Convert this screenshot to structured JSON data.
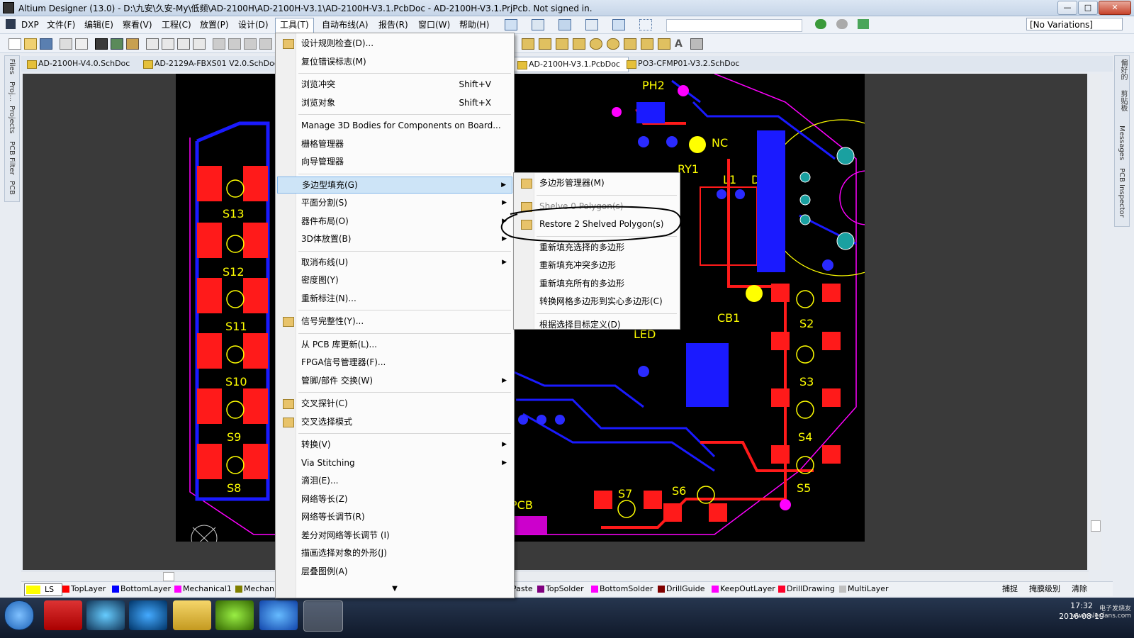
{
  "window": {
    "title": "Altium Designer (13.0) - D:\\九安\\久安-My\\低频\\AD-2100H\\AD-2100H-V3.1\\AD-2100H-V3.1.PcbDoc - AD-2100H-V3.1.PrjPcb. Not signed in.",
    "minimize": "—",
    "maximize": "□",
    "close": "✕"
  },
  "menubar": {
    "items": [
      "DXP",
      "文件(F)",
      "编辑(E)",
      "察看(V)",
      "工程(C)",
      "放置(P)",
      "设计(D)",
      "工具(T)",
      "自动布线(A)",
      "报告(R)",
      "窗口(W)",
      "帮助(H)"
    ],
    "active_index": 7
  },
  "variations": "[No Variations]",
  "doc_tabs": [
    "AD-2100H-V4.0.SchDoc",
    "AD-2129A-FBXS01 V2.0.SchDoc",
    "AD-2100H-V3.1.PcbDoc",
    "PO3-CFMP01-V3.2.SchDoc"
  ],
  "left_panels": [
    "Files",
    "Proj...",
    "Projects",
    "PCB Filter",
    "PCB"
  ],
  "right_panels": [
    "偏好的",
    "剪贴板",
    "Messages",
    "PCB Inspector"
  ],
  "tools_menu": {
    "groups": [
      [
        {
          "label": "设计规则检查(D)...",
          "icon": true
        },
        {
          "label": "复位错误标志(M)"
        }
      ],
      [
        {
          "label": "浏览冲突",
          "shortcut": "Shift+V"
        },
        {
          "label": "浏览对象",
          "shortcut": "Shift+X"
        }
      ],
      [
        {
          "label": "Manage 3D Bodies for Components on Board..."
        },
        {
          "label": "栅格管理器"
        },
        {
          "label": "向导管理器"
        }
      ],
      [
        {
          "label": "多边型填充(G)",
          "submenu": true,
          "highlighted": true
        },
        {
          "label": "平面分割(S)",
          "submenu": true
        },
        {
          "label": "器件布局(O)",
          "submenu": true
        },
        {
          "label": "3D体放置(B)",
          "submenu": true
        }
      ],
      [
        {
          "label": "取消布线(U)",
          "submenu": true
        },
        {
          "label": "密度图(Y)"
        },
        {
          "label": "重新标注(N)..."
        }
      ],
      [
        {
          "label": "信号完整性(Y)...",
          "icon": true
        }
      ],
      [
        {
          "label": "从 PCB 库更新(L)..."
        },
        {
          "label": "FPGA信号管理器(F)..."
        },
        {
          "label": "管脚/部件 交换(W)",
          "submenu": true
        }
      ],
      [
        {
          "label": "交叉探针(C)",
          "icon": true
        },
        {
          "label": "交叉选择模式",
          "icon": true
        }
      ],
      [
        {
          "label": "转换(V)",
          "submenu": true
        },
        {
          "label": "Via Stitching",
          "submenu": true
        },
        {
          "label": "滴泪(E)..."
        },
        {
          "label": "网络等长(Z)"
        },
        {
          "label": "网络等长调节(R)"
        },
        {
          "label": "差分对网络等长调节 (I)"
        },
        {
          "label": "描画选择对象的外形(J)"
        },
        {
          "label": "层叠图例(A)"
        }
      ]
    ],
    "more_arrow": "▼"
  },
  "polygon_submenu": {
    "groups": [
      [
        {
          "label": "多边形管理器(M)",
          "icon": true
        }
      ],
      [
        {
          "label": "Shelve 0 Polygon(s)",
          "icon": true,
          "disabled": true
        },
        {
          "label": "Restore 2 Shelved Polygon(s)",
          "icon": true
        }
      ],
      [
        {
          "label": "重新填充选择的多边形"
        },
        {
          "label": "重新填充冲突多边形"
        },
        {
          "label": "重新填充所有的多边形"
        },
        {
          "label": "转换网格多边形到实心多边形(C)"
        }
      ],
      [
        {
          "label": "根据选择目标定义(D)"
        }
      ]
    ]
  },
  "pcb_labels": [
    "S13",
    "S12",
    "S11",
    "S10",
    "S9",
    "S8",
    "S7",
    "S6",
    "S5",
    "S4",
    "S3",
    "S2",
    "PH2",
    "RY1",
    "CB1",
    "LED",
    "L1",
    "D1",
    "PCB",
    "NC"
  ],
  "layers": [
    {
      "name": "LS",
      "color": "#ffff00"
    },
    {
      "name": "TopLayer",
      "color": "#ff0000"
    },
    {
      "name": "BottomLayer",
      "color": "#0000ff"
    },
    {
      "name": "Mechanical1",
      "color": "#ff00ff"
    },
    {
      "name": "Mechan",
      "color": "#808000"
    },
    {
      "name": "Paste",
      "color": "#808080"
    },
    {
      "name": "TopSolder",
      "color": "#800080"
    },
    {
      "name": "BottomSolder",
      "color": "#ff00ff"
    },
    {
      "name": "DrillGuide",
      "color": "#800000"
    },
    {
      "name": "KeepOutLayer",
      "color": "#ff00ff"
    },
    {
      "name": "DrillDrawing",
      "color": "#ff002a"
    },
    {
      "name": "MultiLayer",
      "color": "#c0c0c0"
    }
  ],
  "status_right": [
    "捕捉",
    "掩膜级别",
    "清除"
  ],
  "clock": {
    "time": "17:32",
    "date": "2016-08-19"
  },
  "watermark": "电子发烧友 www.elecfans.com"
}
